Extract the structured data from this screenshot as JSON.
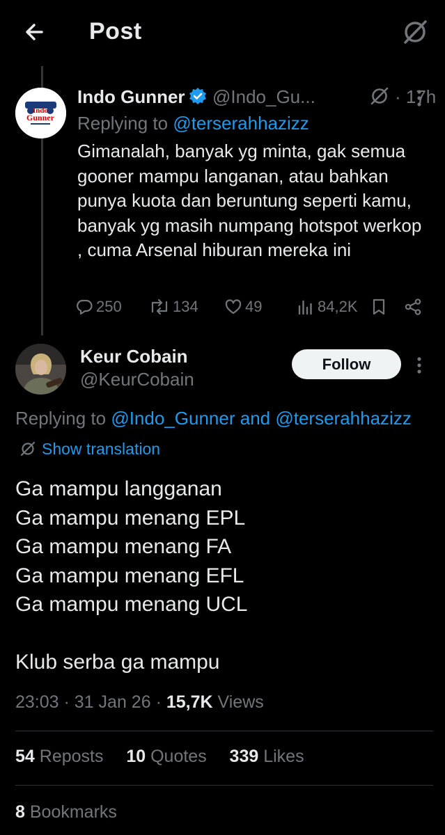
{
  "header": {
    "title": "Post",
    "back_icon": "arrow-left-icon",
    "grok_icon": "grok-icon"
  },
  "parent_tweet": {
    "display_name": "Indo Gunner",
    "verified": true,
    "handle": "@Indo_Gu...",
    "time": "· 17h",
    "replying_prefix": "Replying to",
    "replying_to": "@terserahhazizz",
    "avatar_text": "Indo Gunner",
    "body": "Gimanalah, banyak yg minta, gak semua gooner mampu langanan, atau bahkan punya kuota dan beruntung seperti kamu, banyak yg masih numpang hotspot werkop , cuma Arsenal hiburan mereka ini",
    "replies": "250",
    "reposts": "134",
    "likes": "49",
    "views": "84,2K"
  },
  "main_tweet": {
    "display_name": "Keur Cobain",
    "handle": "@KeurCobain",
    "follow_label": "Follow",
    "replying_prefix": "Replying to",
    "replying_to_1": "@Indo_Gunner",
    "replying_and": "and",
    "replying_to_2": "@terserahhazizz",
    "translate_label": "Show translation",
    "lines": [
      "Ga mampu langganan",
      "Ga mampu menang EPL",
      "Ga mampu menang FA",
      "Ga mampu menang EFL",
      "Ga mampu menang UCL",
      "Klub serba ga mampu"
    ],
    "time": "23:03",
    "date": "31 Jan 26",
    "views_count": "15,7K",
    "views_label": "Views",
    "reposts_count": "54",
    "reposts_label": "Reposts",
    "quotes_count": "10",
    "quotes_label": "Quotes",
    "likes_count": "339",
    "likes_label": "Likes",
    "bookmarks_count": "8",
    "bookmarks_label": "Bookmarks"
  },
  "colors": {
    "background": "#000000",
    "text": "#e7e9ea",
    "muted": "#71767b",
    "link": "#1d9bf0",
    "verified": "#1d9bf0"
  }
}
